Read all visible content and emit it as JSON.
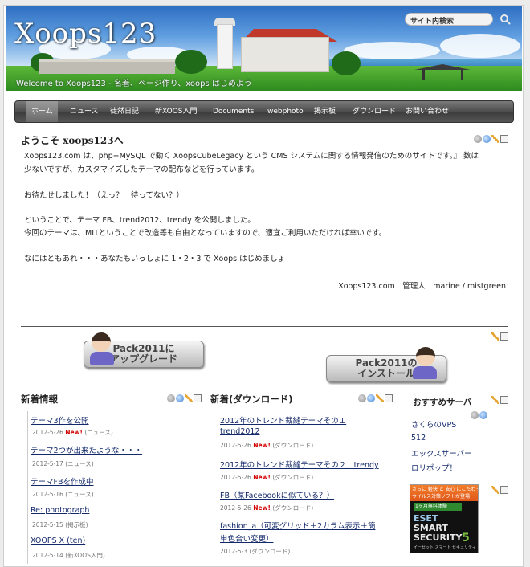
{
  "header": {
    "site_title": "Xoops123",
    "tagline": "Welcome to Xoops123 - 名着、ページ作り、xoops はじめよう",
    "search_placeholder": "サイト内検索"
  },
  "nav": {
    "items": [
      {
        "label": "ホーム",
        "active": true
      },
      {
        "label": "ニュース"
      },
      {
        "label": "徒然日記"
      },
      {
        "label": "新XOOS入門"
      },
      {
        "label": "Documents"
      },
      {
        "label": "webphoto"
      },
      {
        "label": "掲示板"
      },
      {
        "label": "ダウンロード"
      },
      {
        "label": "お問い合わせ"
      }
    ]
  },
  "welcome": {
    "title_prefix": "ようこそ",
    "title_site": "xoops123",
    "title_suffix": "へ",
    "lines": [
      "Xoops123.com は、php+MySQL で動く XoopsCubeLegacy という CMS システムに関する情報発信のためのサイトです。』 数は",
      "少ないですが、カスタマイズしたテーマの配布などを行っています。",
      "お待たせしました！（えっ？　待ってない？）",
      "ということで、テーマ FB、trend2012、trendy を公開しました。",
      "今回のテーマは、MITということで改造等も自由となっていますので、適宜ご利用いただければ幸いです。",
      "なにはともあれ・・・あなたもいっしょに 1・2・3 で Xoops はじめましょ"
    ],
    "signature": "Xoops123.com　管理人　marine / mistgreen"
  },
  "banners": {
    "upgrade": "Pack2011に\nアップグレード",
    "install": "Pack2011の\nインストール"
  },
  "news": {
    "title": "新着情報",
    "items": [
      {
        "title": "テーマ3作を公開",
        "date": "2012-5-26",
        "new": "New!",
        "category": "(ニュース)"
      },
      {
        "title": "テーマ2つが出来たような・・・",
        "date": "2012-5-17",
        "category": "(ニュース)"
      },
      {
        "title": "テーマFBを作成中",
        "date": "2012-5-16",
        "category": "(ニュース)"
      },
      {
        "title": "Re: photograph",
        "date": "2012-5-15",
        "category": "(掲示板)"
      },
      {
        "title": "XOOPS X (ten)",
        "date": "2012-5-14",
        "category": "(新XOOS入門)"
      }
    ]
  },
  "downloads": {
    "title": "新着(ダウンロード)",
    "items": [
      {
        "title_line1": "2012年のトレンド裁縫テーマその１",
        "title_line2": "trend2012",
        "date": "2012-5-26",
        "new": "New!",
        "category": "(ダウンロード)"
      },
      {
        "title_line1": "2012年のトレンド裁縫テーマその２　trendy",
        "date": "2012-5-26",
        "new": "New!",
        "category": "(ダウンロード)"
      },
      {
        "title_line1": "FB（某Facebookに似ている？）",
        "date": "2012-5-26",
        "new": "New!",
        "category": "(ダウンロード)"
      },
      {
        "title_line1": "fashion_a（可変グリッド＋2カラム表示＋簡",
        "title_line2": "単色合い変更）",
        "date": "2012-5-3",
        "category": "(ダウンロード)"
      }
    ]
  },
  "servers": {
    "title": "おすすめサーバ",
    "links": [
      "さくらのVPS",
      "512",
      "エックスサーバー",
      "ロリポップ！"
    ]
  },
  "eset_ad": {
    "band": "さらに 軽快 と 安心 にこだわった\nウイルス対策ソフトが登場！",
    "trial": "1ヶ月無料体験",
    "brand": "ESET",
    "smart": "SMART",
    "security": "SECURITY",
    "version": "5",
    "fine": "イーセット スマート セキュリティ"
  }
}
